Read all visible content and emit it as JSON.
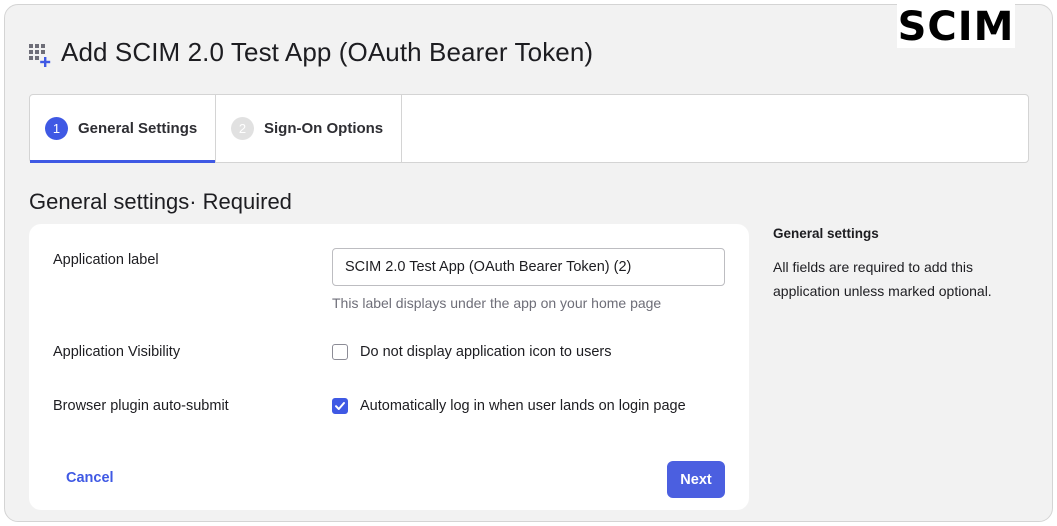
{
  "brand": {
    "logo_text": "SCIM"
  },
  "header": {
    "title": "Add SCIM 2.0 Test App (OAuth Bearer Token)",
    "icon": "app-grid-add-icon"
  },
  "wizard": {
    "steps": [
      {
        "number": "1",
        "label": "General Settings",
        "active": true
      },
      {
        "number": "2",
        "label": "Sign-On Options",
        "active": false
      }
    ]
  },
  "section": {
    "heading": "General settings· Required"
  },
  "form": {
    "application_label": {
      "label": "Application label",
      "value": "SCIM 2.0 Test App (OAuth Bearer Token) (2)",
      "hint": "This label displays under the app on your home page"
    },
    "visibility": {
      "label": "Application Visibility",
      "option": "Do not display application icon to users",
      "checked": false
    },
    "auto_submit": {
      "label": "Browser plugin auto-submit",
      "option": "Automatically log in when user lands on login page",
      "checked": true
    },
    "cancel_label": "Cancel",
    "next_label": "Next"
  },
  "help": {
    "title": "General settings",
    "text": "All fields are required to add this application unless marked optional."
  },
  "colors": {
    "accent": "#3f59e4",
    "background": "#f2f2f2",
    "card": "#ffffff"
  }
}
